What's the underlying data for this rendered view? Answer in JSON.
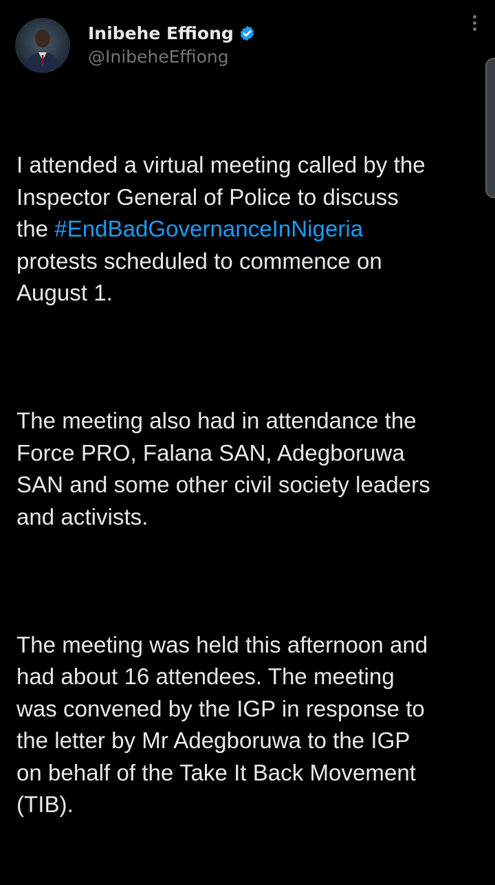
{
  "author": {
    "display_name": "Inibehe Effiong",
    "handle": "@InibeheEffiong",
    "verified": true,
    "verified_icon": "verified-badge-icon",
    "avatar_icon": "profile-photo"
  },
  "menu_icon": "more-options-icon",
  "colors": {
    "background": "#000000",
    "text": "#e7e9ea",
    "muted": "#71767b",
    "link": "#1d9bf0"
  },
  "tweet": {
    "p1_before": "I attended a virtual meeting called by the\nInspector General of Police to discuss\nthe ",
    "p1_hashtag": "#EndBadGovernanceInNigeria",
    "p1_after": "\nprotests scheduled to commence on\nAugust 1.",
    "p2": "The meeting also had in attendance the\nForce PRO, Falana SAN, Adegboruwa\nSAN and some other civil society leaders\nand activists.",
    "p3": "The meeting was held this afternoon and\nhad about 16 attendees. The meeting\nwas convened by the IGP in response to\nthe letter by Mr Adegboruwa to the IGP\non behalf of the Take It Back Movement\n(TIB)."
  }
}
